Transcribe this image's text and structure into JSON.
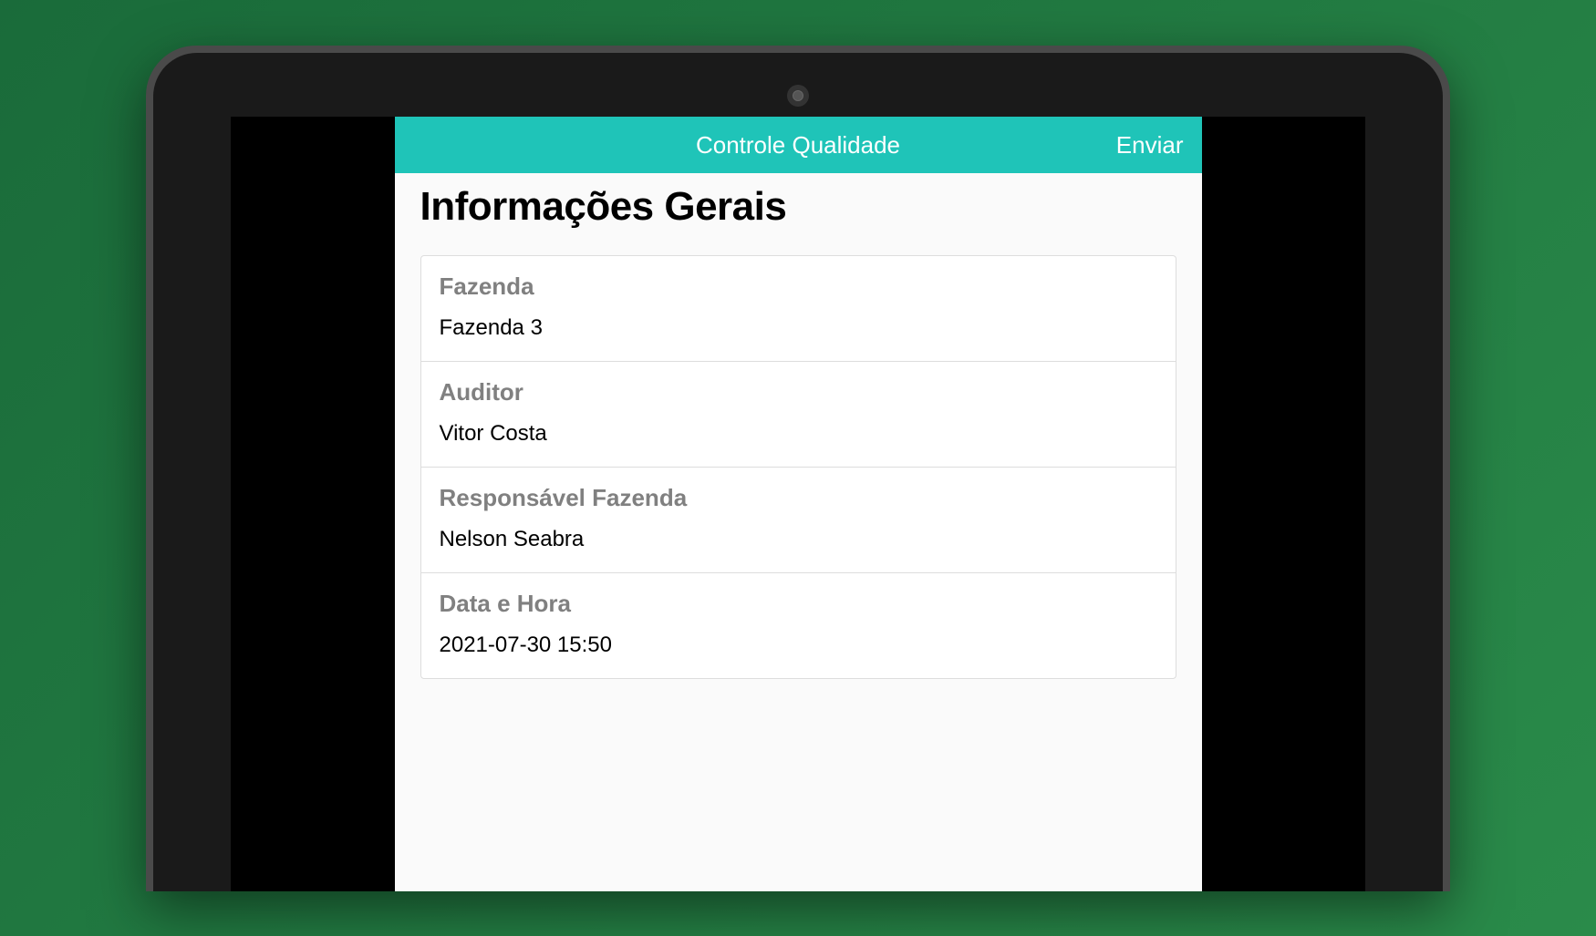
{
  "header": {
    "title": "Controle Qualidade",
    "send_label": "Enviar"
  },
  "page": {
    "heading": "Informações Gerais"
  },
  "fields": [
    {
      "label": "Fazenda",
      "value": "Fazenda 3"
    },
    {
      "label": "Auditor",
      "value": "Vitor Costa"
    },
    {
      "label": "Responsável Fazenda",
      "value": "Nelson Seabra"
    },
    {
      "label": "Data e Hora",
      "value": "2021-07-30 15:50"
    }
  ],
  "colors": {
    "accent": "#1fc4b8"
  }
}
